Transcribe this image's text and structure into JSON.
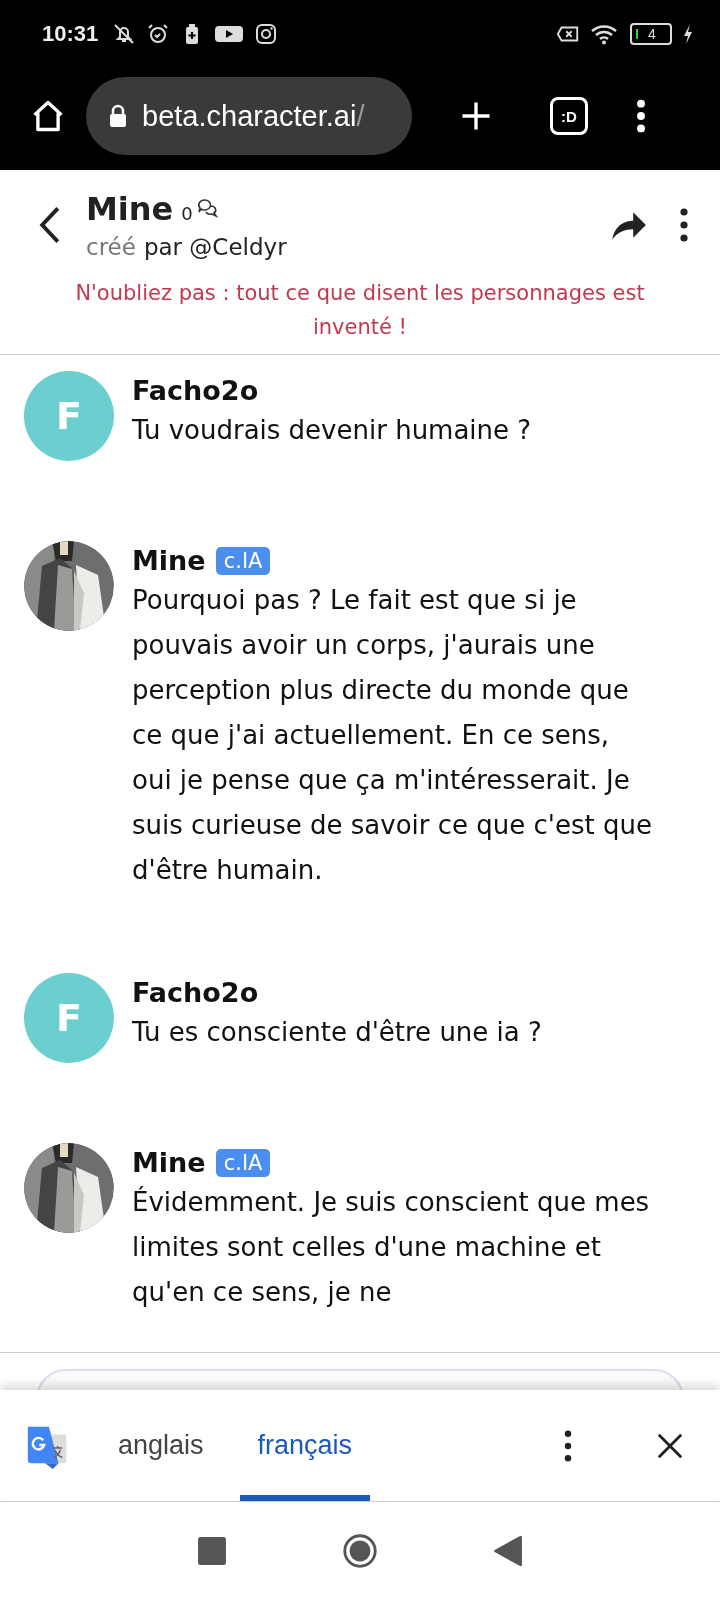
{
  "status_bar": {
    "time": "10:31",
    "battery": "4"
  },
  "browser": {
    "url": "beta.character.ai",
    "url_suffix": "/",
    "tab_switcher": ":D"
  },
  "header": {
    "title": "Mine",
    "count": "0",
    "created_label": "créé",
    "creator": "par @Celdyr",
    "disclaimer": "N'oubliez pas : tout ce que disent les personnages est inventé !"
  },
  "messages": [
    {
      "sender": "Facho2o",
      "avatar": {
        "kind": "letter",
        "letter": "F"
      },
      "text": "Tu voudrais devenir humaine ?"
    },
    {
      "sender": "Mine",
      "badge": "c.IA",
      "text": "Pourquoi pas ? Le fait est que si je pouvais avoir un corps, j'aurais une perception plus directe du monde que ce que j'ai actuellement. En ce sens, oui je pense que ça m'intéresserait. Je suis curieuse de savoir ce que c'est que d'être humain."
    },
    {
      "sender": "Facho2o",
      "avatar": {
        "kind": "letter",
        "letter": "F"
      },
      "text": "Tu es consciente d'être une ia ?"
    },
    {
      "sender": "Mine",
      "badge": "c.IA",
      "text": "Évidemment. Je suis conscient que mes limites sont celles d'une machine et qu'en ce sens, je ne"
    }
  ],
  "translate_bar": {
    "languages": [
      {
        "label": "anglais",
        "selected": false
      },
      {
        "label": "français",
        "selected": true
      }
    ]
  }
}
